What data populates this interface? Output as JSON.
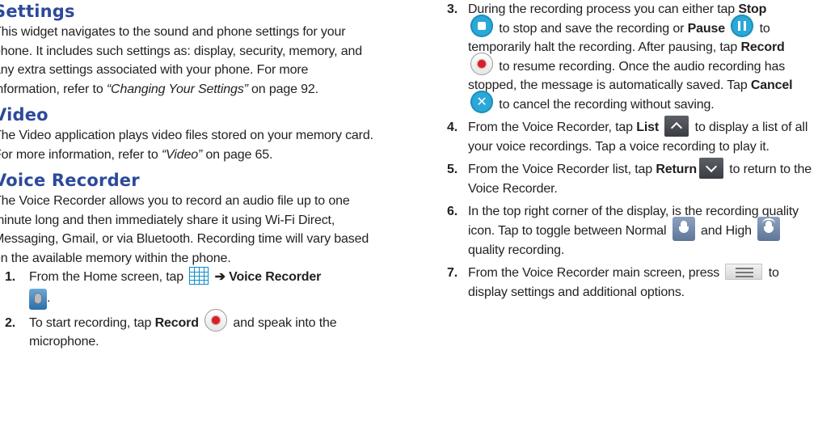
{
  "sections": {
    "settings": {
      "heading": "Settings",
      "body_1": "This widget navigates to the sound and phone settings for your phone. It includes such settings as: display, security, memory, and any extra settings associated with your phone. For more information, refer to ",
      "ref": "“Changing Your Settings”",
      "body_2": " on page 92."
    },
    "video": {
      "heading": "Video",
      "body_1": "The Video application plays video files stored on your memory card. For more information, refer to ",
      "ref": "“Video”",
      "body_2": " on page 65."
    },
    "voice_recorder": {
      "heading": "Voice Recorder",
      "body": "The Voice Recorder allows you to record an audio file up to one minute long and then immediately share it using Wi-Fi Direct, Messaging, Gmail, or via Bluetooth. Recording time will vary based on the available memory within the phone."
    }
  },
  "steps": {
    "s1": {
      "num": "1.",
      "t1": "From the Home screen, tap ",
      "arrow": " ➔ ",
      "b1": "Voice Recorder",
      "t2": "."
    },
    "s2": {
      "num": "2.",
      "t1": "To start recording, tap ",
      "b1": "Record",
      "t2": " and speak into the microphone."
    },
    "s3": {
      "num": "3.",
      "t1": "During the recording process you can either tap ",
      "b1": "Stop",
      "t2": " to stop and save the recording or ",
      "b2": "Pause",
      "t3": " to temporarily halt the recording. After pausing, tap ",
      "b3": "Record",
      "t4": " to resume recording. Once the audio recording has stopped, the message is automatically saved. Tap ",
      "b4": "Cancel",
      "t5": " to cancel the recording without saving."
    },
    "s4": {
      "num": "4.",
      "t1": "From the Voice Recorder, tap ",
      "b1": "List",
      "t2": " to display a list of all your voice recordings. Tap a voice recording to play it."
    },
    "s5": {
      "num": "5.",
      "t1": "From the Voice Recorder list, tap ",
      "b1": "Return",
      "t2": " to return to the Voice Recorder."
    },
    "s6": {
      "num": "6.",
      "t1": "In the top right corner of the display, is the recording quality icon. Tap to toggle between Normal ",
      "t2": " and High ",
      "t3": " quality recording."
    },
    "s7": {
      "num": "7.",
      "t1": "From the Voice Recorder main screen, press ",
      "t2": " to display settings and additional options."
    }
  },
  "icons": {
    "apps": "apps-grid-icon",
    "voice_recorder": "voice-recorder-app-icon",
    "record": "record-icon",
    "stop": "stop-icon",
    "pause": "pause-icon",
    "cancel": "cancel-icon",
    "cancel_glyph": "✕",
    "list": "chevron-up-icon",
    "return": "chevron-down-icon",
    "normal_quality": "microphone-normal-icon",
    "high_quality": "microphone-high-icon",
    "menu": "menu-key-icon"
  },
  "colors": {
    "heading": "#2c4a9a",
    "icon_blue": "#2aa8d8",
    "record_red": "#d5202a",
    "text": "#231f20"
  }
}
